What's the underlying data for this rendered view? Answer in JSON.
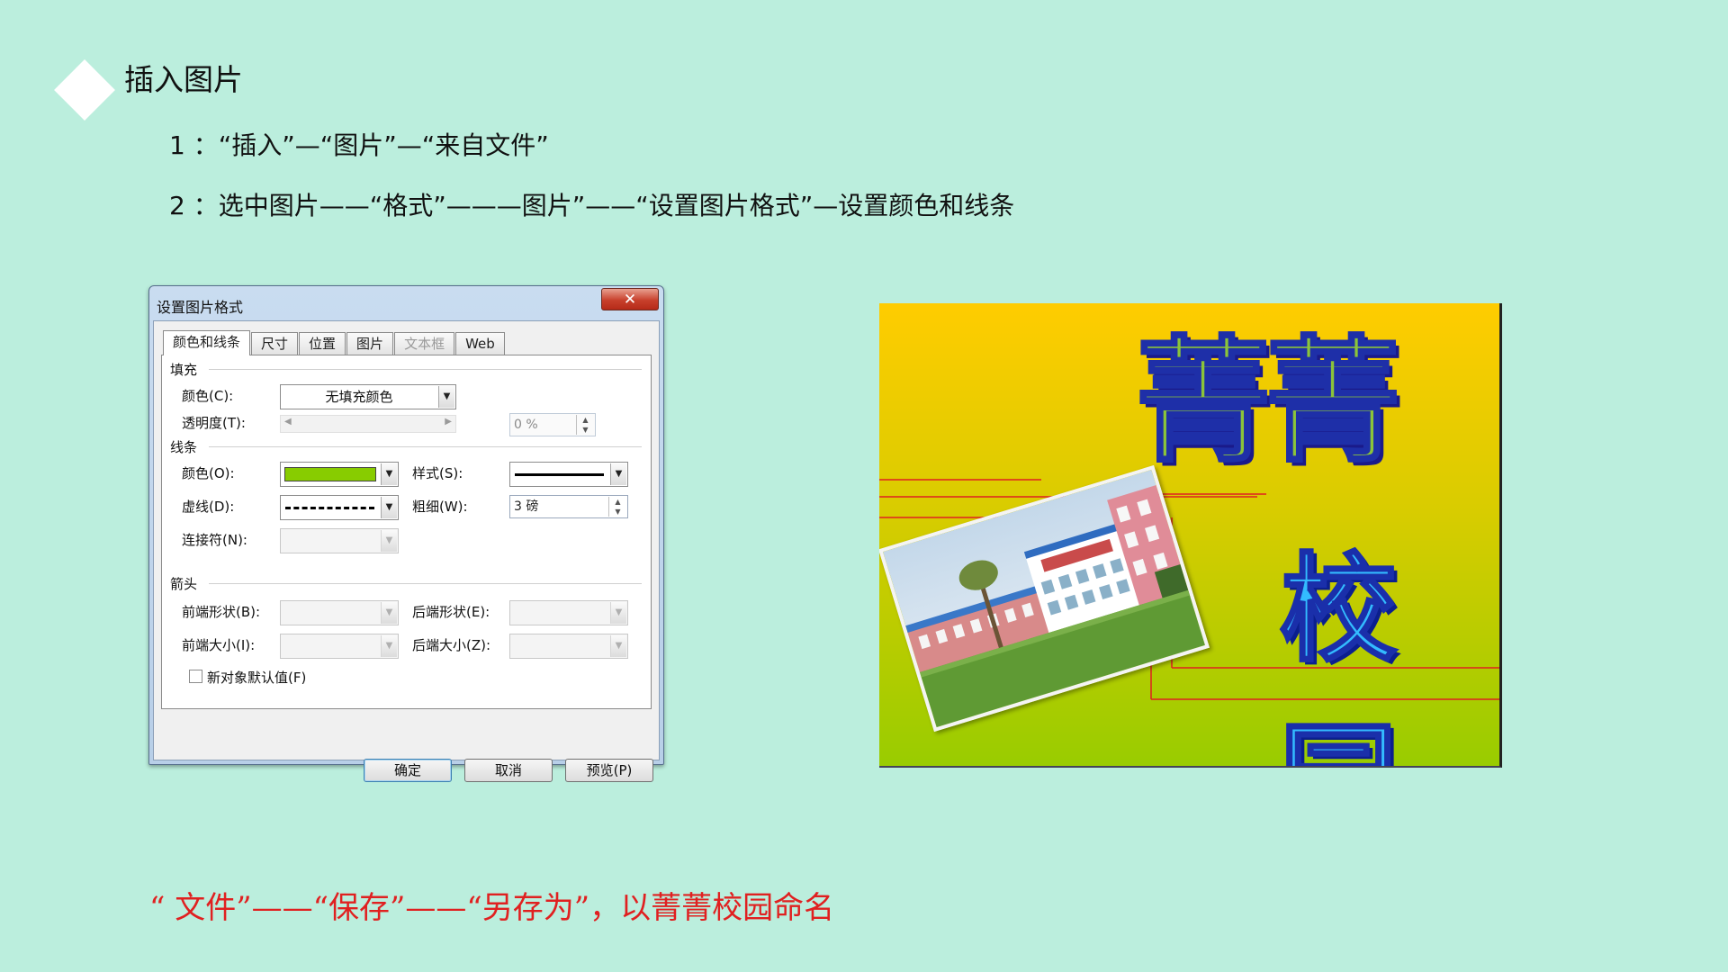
{
  "slide": {
    "title": "插入图片",
    "step1": "1 ：“插入”—“图片”—“来自文件”",
    "step2": "2 ：选中图片——“格式”———图片”——“设置图片格式”—设置颜色和线条",
    "note": "“ 文件”——“保存”——“另存为”，以菁菁校园命名"
  },
  "dialog": {
    "title": "设置图片格式",
    "close_label": "✕",
    "tabs": [
      {
        "label": "颜色和线条",
        "state": "active"
      },
      {
        "label": "尺寸",
        "state": "normal"
      },
      {
        "label": "位置",
        "state": "normal"
      },
      {
        "label": "图片",
        "state": "normal"
      },
      {
        "label": "文本框",
        "state": "disabled"
      },
      {
        "label": "Web",
        "state": "normal"
      }
    ],
    "fill": {
      "section": "填充",
      "color_label": "颜色(C):",
      "color_value": "无填充颜色",
      "transparency_label": "透明度(T):",
      "transparency_value": "0 %"
    },
    "line": {
      "section": "线条",
      "color_label": "颜色(O):",
      "color_value": "#88cc00",
      "style_label": "样式(S):",
      "dash_label": "虚线(D):",
      "weight_label": "粗细(W):",
      "weight_value": "3 磅",
      "connector_label": "连接符(N):"
    },
    "arrows": {
      "section": "箭头",
      "begin_style_label": "前端形状(B):",
      "end_style_label": "后端形状(E):",
      "begin_size_label": "前端大小(I):",
      "end_size_label": "后端大小(Z):"
    },
    "default_checkbox_label": "新对象默认值(F)",
    "default_checkbox_checked": false,
    "buttons": {
      "ok": "确定",
      "cancel": "取消",
      "preview": "预览(P)"
    }
  },
  "artwork": {
    "top_text": "菁菁",
    "bottom_text": "校园"
  }
}
